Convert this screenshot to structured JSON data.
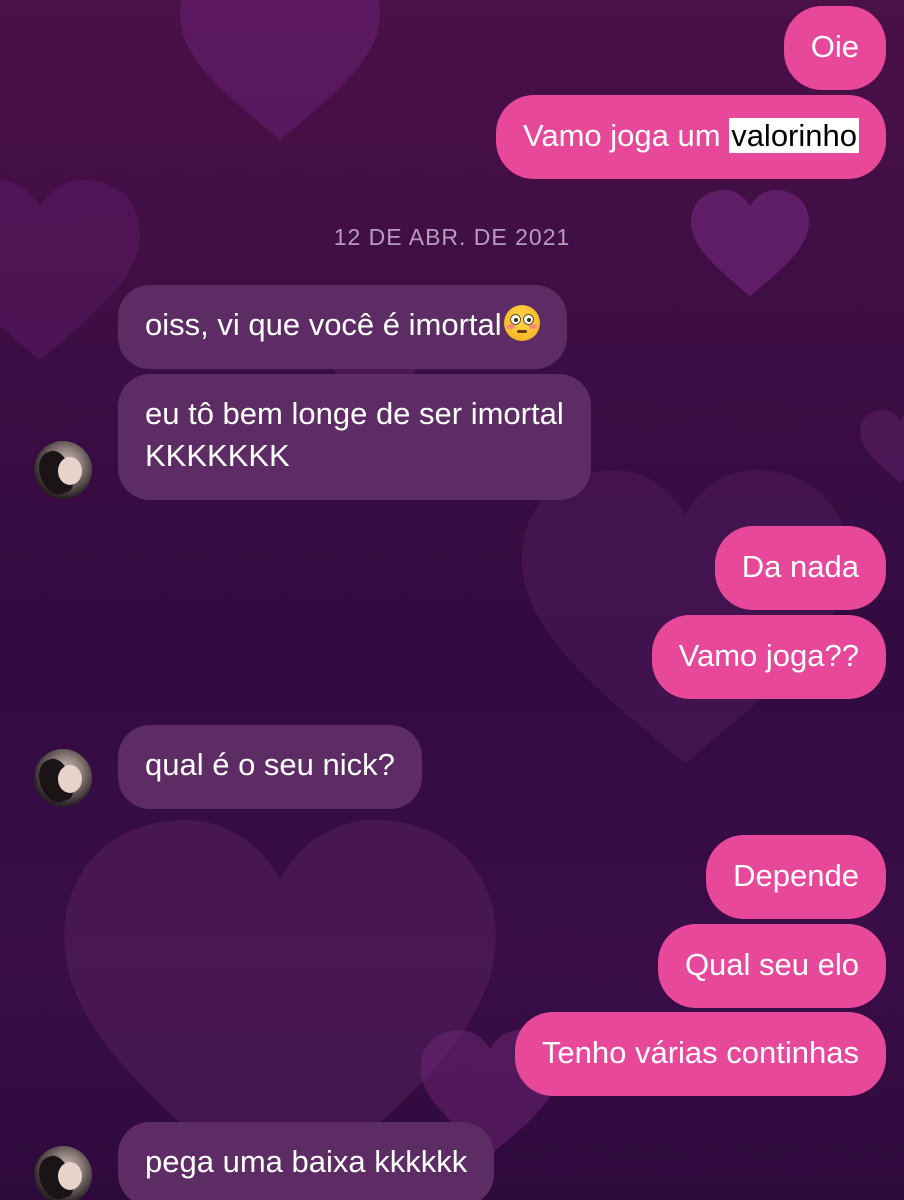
{
  "conversation": {
    "date_separator": "12 DE ABR. DE 2021",
    "messages": [
      {
        "from": "me",
        "text": "Oie"
      },
      {
        "from": "me",
        "text_before": "Vamo joga um ",
        "text_highlight": "valorinho"
      },
      {
        "from": "them",
        "text": "oiss, vi que você é imortal",
        "emoji": "flushed-face-emoji"
      },
      {
        "from": "them",
        "line1": "eu tô bem longe de ser imortal",
        "line2": "KKKKKKK"
      },
      {
        "from": "me",
        "text": "Da nada"
      },
      {
        "from": "me",
        "text": "Vamo joga??"
      },
      {
        "from": "them",
        "text": "qual é o seu nick?"
      },
      {
        "from": "me",
        "text": "Depende"
      },
      {
        "from": "me",
        "text": "Qual seu elo"
      },
      {
        "from": "me",
        "text": "Tenho várias continhas"
      },
      {
        "from": "them",
        "text": "pega uma baixa kkkkkk"
      }
    ]
  },
  "colors": {
    "outgoing_bubble": "#e8489a",
    "incoming_bubble": "#5e2c64",
    "date_text": "#b79cc0",
    "background": "#3c0d44"
  }
}
